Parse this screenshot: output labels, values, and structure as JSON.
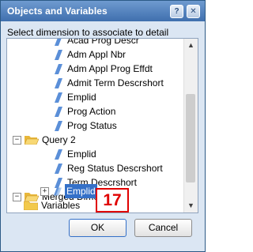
{
  "dialog": {
    "title": "Objects and Variables",
    "instruction": "Select dimension to associate to detail",
    "help_glyph": "?",
    "close_glyph": "✕"
  },
  "tree": {
    "items": [
      {
        "label": "Acad Prog Descr",
        "kind": "dimension"
      },
      {
        "label": "Adm Appl Nbr",
        "kind": "dimension"
      },
      {
        "label": "Adm Appl Prog Effdt",
        "kind": "dimension"
      },
      {
        "label": "Admit Term Descrshort",
        "kind": "dimension"
      },
      {
        "label": "Emplid",
        "kind": "dimension"
      },
      {
        "label": "Prog Action",
        "kind": "dimension"
      },
      {
        "label": "Prog Status",
        "kind": "dimension"
      },
      {
        "label": "Query 2",
        "kind": "folder",
        "expander": "−"
      },
      {
        "label": "Emplid",
        "kind": "dimension"
      },
      {
        "label": "Reg Status Descrshort",
        "kind": "dimension"
      },
      {
        "label": "Term Descrshort",
        "kind": "dimension"
      },
      {
        "label": "Merged Dimensions",
        "kind": "folder",
        "expander": "−"
      },
      {
        "label": "Emplid",
        "kind": "merged-dimension",
        "expander": "+",
        "selected": true
      },
      {
        "label": "Variables",
        "kind": "folder"
      }
    ]
  },
  "scrollbar": {
    "up": "▲",
    "down": "▼"
  },
  "buttons": {
    "ok": "OK",
    "cancel": "Cancel"
  },
  "annotation": {
    "step": "17"
  },
  "colors": {
    "titlebar": "#4a7bbd",
    "selection": "#3470c8",
    "dimension_icon": "#5b8fd8",
    "folder": "#f2c94c",
    "marker": "#e00000"
  }
}
